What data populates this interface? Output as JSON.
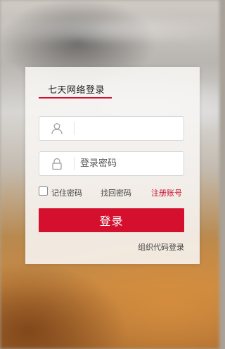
{
  "login": {
    "tab_title": "七天网络登录",
    "username": {
      "value": "",
      "placeholder": ""
    },
    "password": {
      "value": "",
      "placeholder": "登录密码"
    },
    "remember_label": "记住密码",
    "forgot_label": "找回密码",
    "register_label": "注册账号",
    "submit_label": "登录",
    "org_login_label": "组织代码登录"
  },
  "colors": {
    "accent": "#d5102f",
    "register_link": "#c8102e"
  },
  "icons": [
    "user-icon",
    "lock-icon"
  ]
}
